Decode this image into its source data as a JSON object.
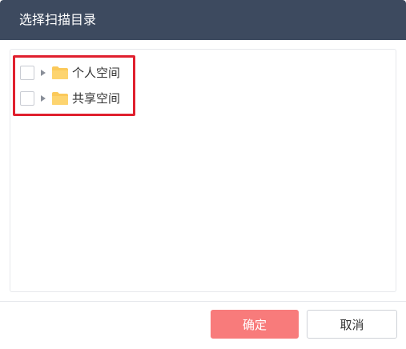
{
  "dialog": {
    "title": "选择扫描目录"
  },
  "tree": {
    "nodes": [
      {
        "label": "个人空间",
        "checked": false,
        "expanded": false,
        "icon": "folder-icon"
      },
      {
        "label": "共享空间",
        "checked": false,
        "expanded": false,
        "icon": "folder-icon"
      }
    ]
  },
  "footer": {
    "confirm_label": "确定",
    "cancel_label": "取消"
  },
  "colors": {
    "header_bg": "#3d4a5f",
    "confirm_bg": "#f87b7b",
    "folder": "#fbc95a",
    "highlight": "#e0202e"
  }
}
